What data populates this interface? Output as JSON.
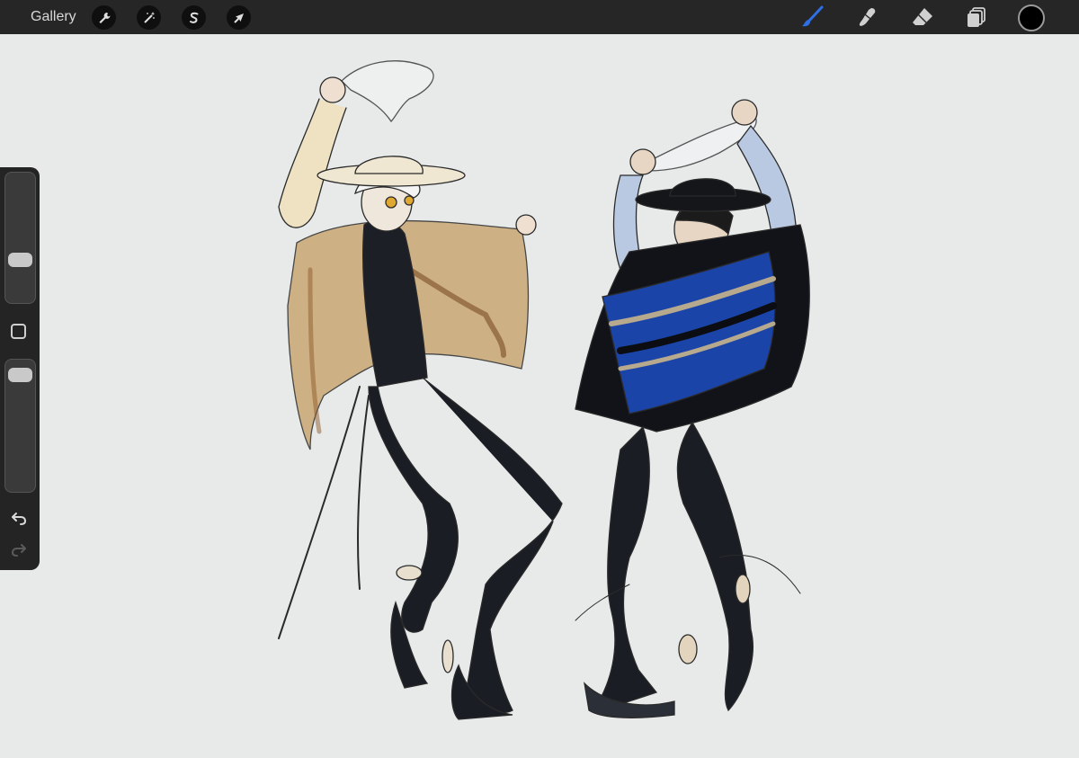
{
  "topbar": {
    "gallery_label": "Gallery",
    "left_tools": [
      {
        "name": "actions",
        "icon": "wrench-icon"
      },
      {
        "name": "adjustments",
        "icon": "magic-wand-icon"
      },
      {
        "name": "selection",
        "icon": "selection-s-icon"
      },
      {
        "name": "transform",
        "icon": "arrow-cursor-icon"
      }
    ],
    "right_tools": [
      {
        "name": "brush",
        "icon": "brush-icon",
        "active": true,
        "color": "#2f6fe6"
      },
      {
        "name": "smudge",
        "icon": "smudge-icon",
        "active": false
      },
      {
        "name": "eraser",
        "icon": "eraser-icon",
        "active": false
      },
      {
        "name": "layers",
        "icon": "layers-icon",
        "active": false
      }
    ],
    "current_color": "#000000"
  },
  "sidebar": {
    "brush_size_level": 0.3,
    "opacity_level": 0.05,
    "undo_icon": "undo-icon",
    "redo_icon": "redo-icon",
    "modify_icon": "square-icon"
  },
  "canvas": {
    "background_color": "#e8eaea",
    "artwork": "sketch-of-two-dancers"
  }
}
